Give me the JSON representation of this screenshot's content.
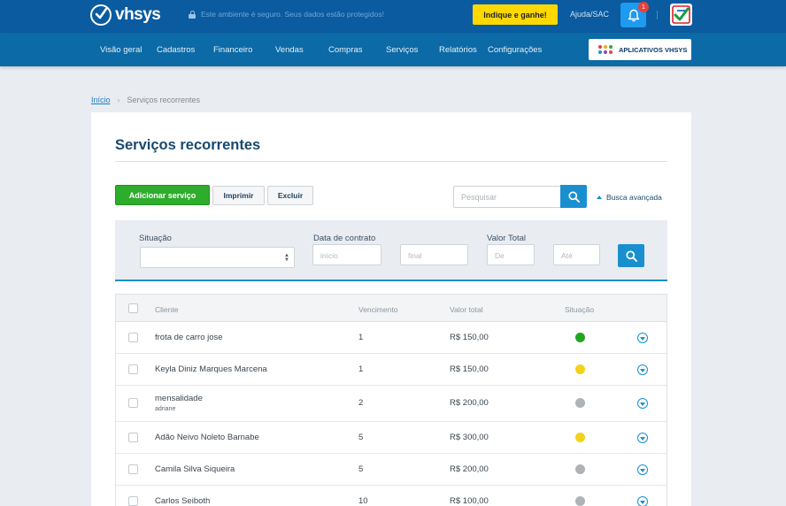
{
  "header": {
    "logo_text": "vhsys",
    "secure_notice": "Este ambiente é seguro. Seus dados estão protegidos!",
    "indique_label": "Indique e ganhe!",
    "ajuda_label": "Ajuda/SAC",
    "notification_count": "1"
  },
  "nav": {
    "items": [
      "Visão geral",
      "Cadastros",
      "Financeiro",
      "Vendas",
      "Compras",
      "Serviços",
      "Relatórios",
      "Configurações"
    ],
    "apps_label": "APLICATIVOS VHSYS"
  },
  "breadcrumb": {
    "home": "Início",
    "current": "Serviços recorrentes"
  },
  "page": {
    "title": "Serviços recorrentes"
  },
  "toolbar": {
    "add_label": "Adicionar serviço",
    "print_label": "Imprimir",
    "delete_label": "Excluir",
    "search_placeholder": "Pesquisar",
    "advanced_label": "Busca avançada"
  },
  "filters": {
    "situacao_label": "Situação",
    "situacao_value": "",
    "data_label": "Data de contrato",
    "data_inicio_placeholder": "início",
    "data_final_placeholder": "final",
    "valor_label": "Valor Total",
    "valor_de_placeholder": "De",
    "valor_ate_placeholder": "Até"
  },
  "table": {
    "columns": [
      "Cliente",
      "Vencimento",
      "Valor total",
      "Situação"
    ],
    "rows": [
      {
        "cliente": "frota de carro jose",
        "sub": "",
        "vencimento": "1",
        "valor": "R$ 150,00",
        "status_color": "#22a522"
      },
      {
        "cliente": "Keyla Diniz Marques Marcena",
        "sub": "",
        "vencimento": "1",
        "valor": "R$ 150,00",
        "status_color": "#f2d21a"
      },
      {
        "cliente": "mensalidade",
        "sub": "adriane",
        "vencimento": "2",
        "valor": "R$ 200,00",
        "status_color": "#b0b3b6"
      },
      {
        "cliente": "Adão Neivo Noleto Barnabe",
        "sub": "",
        "vencimento": "5",
        "valor": "R$ 300,00",
        "status_color": "#f2d21a"
      },
      {
        "cliente": "Camila Silva Siqueira",
        "sub": "",
        "vencimento": "5",
        "valor": "R$ 200,00",
        "status_color": "#b0b3b6"
      },
      {
        "cliente": "Carlos Seiboth",
        "sub": "",
        "vencimento": "10",
        "valor": "R$ 100,00",
        "status_color": "#b0b3b6"
      }
    ]
  },
  "colors": {
    "topbar": "#0a5ba0",
    "navbar": "#0c6aa6",
    "accent": "#1a8fd0",
    "add_button": "#2eac2c",
    "indique": "#ffd800"
  }
}
